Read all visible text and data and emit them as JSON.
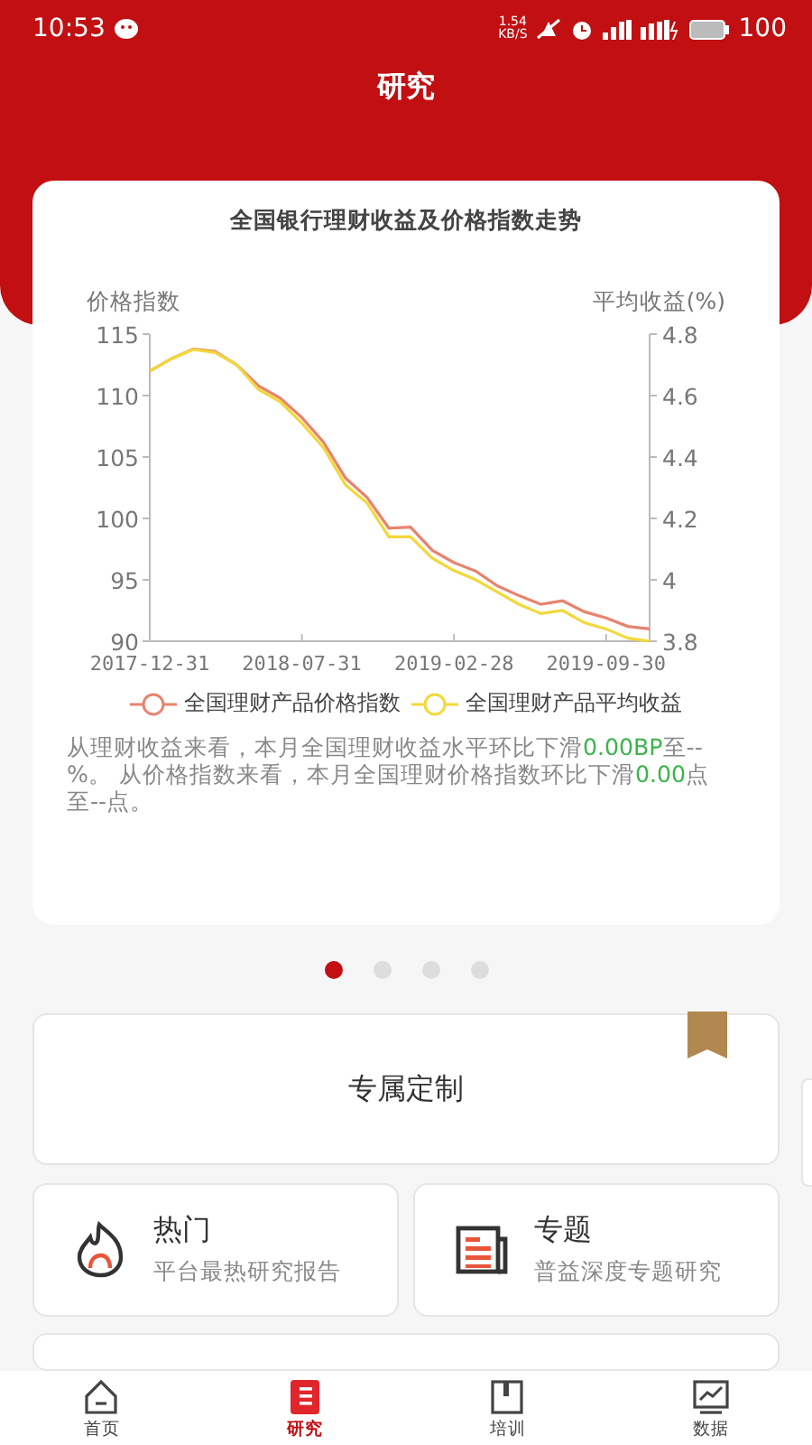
{
  "status_bar": {
    "time": "10:53",
    "speed": "1.54",
    "speed_unit": "KB/S",
    "battery": "100"
  },
  "header": {
    "title": "研究"
  },
  "carousel": {
    "card": {
      "chart_data": {
        "type": "line",
        "title": "全国银行理财收益及价格指数走势",
        "ylabel": "价格指数",
        "y2label": "平均收益(%)",
        "categories": [
          "2017-12-31",
          null,
          null,
          null,
          null,
          null,
          null,
          "2018-07-31",
          null,
          null,
          null,
          null,
          null,
          null,
          "2019-02-28",
          null,
          null,
          null,
          null,
          null,
          null,
          "2019-09-30",
          null,
          null
        ],
        "ylim": [
          90,
          115
        ],
        "yticks": [
          90,
          95,
          100,
          105,
          110,
          115
        ],
        "y2lim": [
          3.8,
          4.8
        ],
        "y2ticks": [
          {
            "value": 3.8,
            "label": "3.8"
          },
          {
            "value": 4.0,
            "label": "4"
          },
          {
            "value": 4.2,
            "label": "4.2"
          },
          {
            "value": 4.4,
            "label": "4.4"
          },
          {
            "value": 4.6,
            "label": "4.6"
          },
          {
            "value": 4.8,
            "label": "4.8"
          }
        ],
        "series": [
          {
            "name": "全国理财产品价格指数",
            "color": "#e8836f",
            "values": [
              112,
              113,
              113.8,
              113.6,
              112.5,
              110.8,
              109.8,
              108.2,
              106.2,
              103.3,
              101.7,
              99.2,
              99.3,
              97.4,
              96.4,
              95.7,
              94.5,
              93.7,
              93.0,
              93.3,
              92.4,
              91.9,
              91.2,
              91.0
            ]
          },
          {
            "name": "全国理财产品平均收益",
            "color": "#f3d83a",
            "axis": "y2",
            "values": [
              4.68,
              4.72,
              4.75,
              4.74,
              4.7,
              4.62,
              4.58,
              4.51,
              4.43,
              4.31,
              4.25,
              4.14,
              4.14,
              4.07,
              4.03,
              4.0,
              3.96,
              3.92,
              3.89,
              3.9,
              3.86,
              3.84,
              3.81,
              3.8
            ]
          }
        ]
      },
      "summary": "从理财收益来看，本月全国理财收益水平环比下滑**0.00BP**至--%。 从价格指数来看，本月全国理财价格指数环比下滑**0.00**点至--点。"
    },
    "dots": [
      {
        "selected": true
      },
      {
        "selected": false
      },
      {
        "selected": false
      },
      {
        "selected": false
      }
    ]
  },
  "custom_card": {
    "title": "专属定制"
  },
  "features": [
    {
      "kind": "hot",
      "title": "热门",
      "subtitle": "平台最热研究报告"
    },
    {
      "kind": "topic",
      "title": "专题",
      "subtitle": "普益深度专题研究"
    }
  ],
  "tab_bar": [
    {
      "kind": "home",
      "label": "首页",
      "selected": false
    },
    {
      "kind": "research",
      "label": "研究",
      "selected": true
    },
    {
      "kind": "training",
      "label": "培训",
      "selected": false
    },
    {
      "kind": "data",
      "label": "数据",
      "selected": false
    }
  ]
}
